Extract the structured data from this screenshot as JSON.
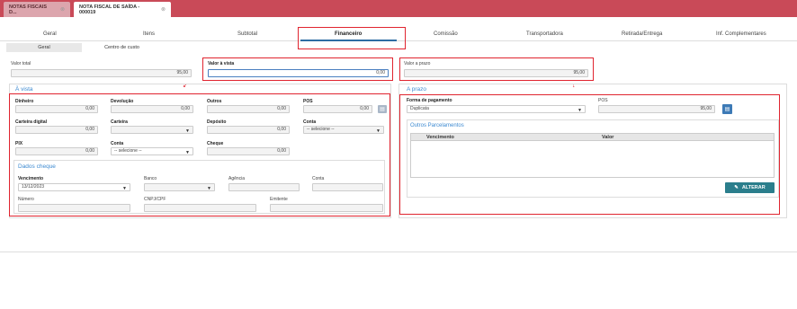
{
  "tabs": {
    "tab1": "NOTAS FISCAIS D...",
    "tab2": "NOTA FISCAL DE SAÍDA - 000019",
    "close": "⊗"
  },
  "nav": [
    "Geral",
    "Itens",
    "Subtotal",
    "Financeiro",
    "Comissão",
    "Transportadora",
    "Retirada/Entrega",
    "Inf. Complementares"
  ],
  "subtabs": [
    "Geral",
    "Centro de custo"
  ],
  "totals": {
    "valor_total_label": "Valor total",
    "valor_total": "95,00",
    "valor_vista_label": "Valor à vista",
    "valor_vista": "0,00",
    "valor_prazo_label": "Valor a prazo",
    "valor_prazo": "95,00"
  },
  "a_vista": {
    "title": "À vista",
    "dinheiro_label": "Dinheiro",
    "dinheiro": "0,00",
    "devolucao_label": "Devolução",
    "devolucao": "0,00",
    "outros_label": "Outros",
    "outros": "0,00",
    "pos_label": "POS",
    "pos": "0,00",
    "carteira_digital_label": "Carteira digital",
    "carteira_digital": "0,00",
    "carteira_label": "Carteira",
    "deposito_label": "Depósito",
    "deposito": "0,00",
    "conta_label": "Conta",
    "conta": "-- selecione --",
    "pix_label": "PIX",
    "pix": "0,00",
    "conta2_label": "Conta",
    "conta2": "-- selecione --",
    "cheque_label": "Cheque",
    "cheque": "0,00"
  },
  "dados_cheque": {
    "title": "Dados cheque",
    "vencimento_label": "Vencimento",
    "vencimento": "13/12/2023",
    "banco_label": "Banco",
    "agencia_label": "Agência",
    "conta_label": "Conta",
    "numero_label": "Número",
    "cnpj_label": "CNPJ/CPF",
    "emitente_label": "Emitente"
  },
  "a_prazo": {
    "title": "A prazo",
    "forma_label": "Forma de pagamento",
    "forma": "Duplicata",
    "pos_label": "POS",
    "pos": "95,00",
    "outros_title": "Outros Parcelamentos",
    "col_vencimento": "Vencimento",
    "col_valor": "Valor",
    "alterar": "ALTERAR"
  },
  "colors": {
    "accent": "#c94a58",
    "link": "#3d8ad1",
    "button": "#2b7e8c",
    "highlight": "#e0242f"
  }
}
